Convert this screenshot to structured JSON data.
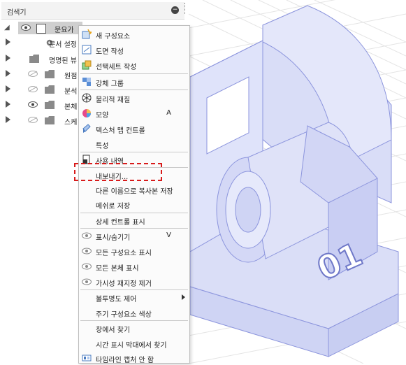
{
  "browser": {
    "title": "검색기",
    "root_label": "문요가",
    "items": [
      {
        "label": "문서 설정",
        "icon": "gear-icon"
      },
      {
        "label": "명명된 뷰",
        "icon": "folder-icon"
      },
      {
        "label": "원점",
        "icon": "folder-icon"
      },
      {
        "label": "분석",
        "icon": "folder-icon"
      },
      {
        "label": "본체",
        "icon": "folder-icon"
      },
      {
        "label": "스케",
        "icon": "folder-icon"
      }
    ]
  },
  "context_menu": {
    "items": [
      {
        "label": "새 구성요소",
        "icon": "new-component-icon"
      },
      {
        "label": "도면 작성",
        "icon": "drawing-icon"
      },
      {
        "label": "선택세트 작성",
        "icon": "selection-set-icon"
      },
      {
        "label": "강체 그룹",
        "icon": "rigid-group-icon"
      },
      {
        "label": "물리적 재질",
        "icon": "material-icon"
      },
      {
        "label": "모양",
        "icon": "appearance-icon",
        "shortcut": "A"
      },
      {
        "label": "텍스처 맵 컨트롤",
        "icon": "texture-map-icon"
      },
      {
        "label": "특성"
      },
      {
        "label": "사용 내역",
        "icon": "usage-icon"
      },
      {
        "label": "내보내기..."
      },
      {
        "label": "다른 이름으로 복사본 저장"
      },
      {
        "label": "메쉬로 저장"
      },
      {
        "label": "상세 컨트롤 표시"
      },
      {
        "label": "표시/숨기기",
        "icon": "eye-icon",
        "shortcut": "V"
      },
      {
        "label": "모든 구성요소 표시",
        "icon": "eye-icon"
      },
      {
        "label": "모든 본체 표시",
        "icon": "eye-icon"
      },
      {
        "label": "가시성 재지정 제거",
        "icon": "eye-icon"
      },
      {
        "label": "불투명도 제어",
        "has_submenu": true
      },
      {
        "label": "주기 구성요소 색상"
      },
      {
        "label": "창에서 찾기"
      },
      {
        "label": "시간 표시 막대에서 찾기"
      },
      {
        "label": "타임라인 캡처 안 함",
        "icon": "timeline-icon"
      }
    ]
  },
  "model_text": "01",
  "colors": {
    "highlight": "#d81b1b",
    "model_fill": "#d9ddf7",
    "model_edge": "#9aa3e6"
  }
}
